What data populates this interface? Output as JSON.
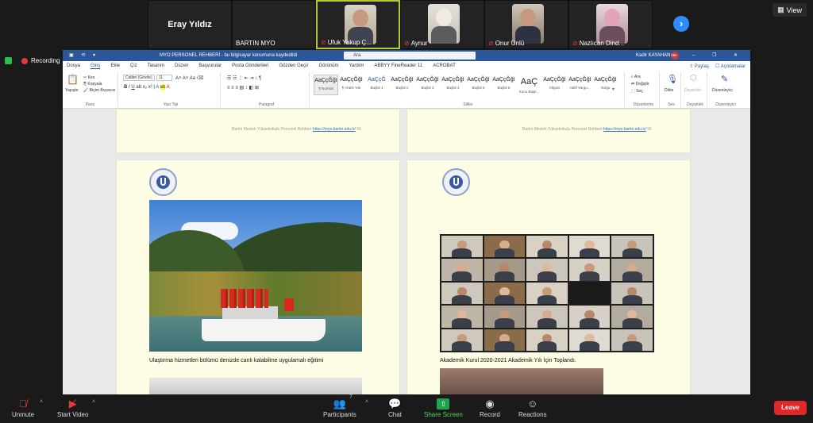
{
  "participants": [
    {
      "name": "Eray Yıldız",
      "has_video": false,
      "muted": false
    },
    {
      "name": "BARTIN MYO",
      "has_video": false,
      "muted": false
    },
    {
      "name": "Ufuk Yakup Ç...",
      "has_video": true,
      "muted": true,
      "active_speaker": true
    },
    {
      "name": "Aynur",
      "has_video": true,
      "muted": true
    },
    {
      "name": "Onur Ünlü",
      "has_video": true,
      "muted": true
    },
    {
      "name": "Nazlıcan Dind...",
      "has_video": true,
      "muted": true
    }
  ],
  "top": {
    "view_label": "View",
    "recording_label": "Recording",
    "next_icon": "chevron-right-icon"
  },
  "word": {
    "doc_title": "MYO PERSONEL REHBERİ  -  bu bilgisayar konumuna kaydedildi",
    "search_placeholder": "Ara",
    "user_name": "Kadir KAYAHAN",
    "user_initials": "KK",
    "menu": [
      "Dosya",
      "Giriş",
      "Ekle",
      "Çiz",
      "Tasarım",
      "Düzen",
      "Başvurular",
      "Posta Gönderileri",
      "Gözden Geçir",
      "Görünüm",
      "Yardım",
      "ABBYY FineReader 11",
      "ACROBAT"
    ],
    "active_menu": "Giriş",
    "share_label": "Paylaş",
    "comments_label": "Açıklamalar",
    "ribbon": {
      "paste": "Yapıştır",
      "cut": "Kes",
      "copy": "Kopyala",
      "format_painter": "Biçim Boyacısı",
      "clipboard_group": "Pano",
      "font_name": "Calibri (Gövde)",
      "font_size": "11",
      "font_group": "Yazı Tipi",
      "paragraph_group": "Paragraf",
      "styles_group": "Stiller",
      "styles": [
        {
          "sample": "AaÇçĞğI",
          "name": "¶ Normal"
        },
        {
          "sample": "AaÇçĞğI",
          "name": "¶ Aralık Yok"
        },
        {
          "sample": "AaÇçĞ",
          "name": "Başlık 1"
        },
        {
          "sample": "AaÇçĞğI",
          "name": "Başlık 2"
        },
        {
          "sample": "AaÇçĞğI",
          "name": "Başlık 3"
        },
        {
          "sample": "AaÇçĞğI",
          "name": "Başlık 4"
        },
        {
          "sample": "AaÇçĞğI",
          "name": "Başlık 5"
        },
        {
          "sample": "AaÇçĞğI",
          "name": "Başlık 6"
        },
        {
          "sample": "AaÇ",
          "name": "Konu Başlı..."
        },
        {
          "sample": "AaÇçĞğI",
          "name": "Altyazı"
        },
        {
          "sample": "AaÇçĞğI",
          "name": "Hafif Vurgu..."
        },
        {
          "sample": "AaÇçĞğI",
          "name": "Vurgu"
        }
      ],
      "find": "Ara",
      "replace": "Değiştir",
      "select": "Seç",
      "editing_group": "Düzenleme",
      "dictate": "Dikte",
      "voice_group": "Ses",
      "sensitivity": "Duyarlılık",
      "sensitivity_group": "Duyarlılık",
      "editor": "Düzenleyici",
      "editor_group": "Düzenleyici"
    },
    "pages": {
      "footer_text": "Bartın Meslek Yüksekokulu Personel Rehberi-",
      "footer_link": "https://myo.bartin.edu.tr/",
      "footer_page": "56",
      "footer_page_right": "56",
      "caption_left": "Ulaştırma hizmetleri bölümü denizde canlı kalabilme uygulamalı eğitimi",
      "caption_right": "Akademik Kurul 2020-2021 Akademik Yılı İçin Toplandı."
    }
  },
  "bottom": {
    "unmute": "Unmute",
    "start_video": "Start Video",
    "participants": "Participants",
    "participants_count": "7",
    "chat": "Chat",
    "share_screen": "Share Screen",
    "record": "Record",
    "reactions": "Reactions",
    "leave": "Leave"
  },
  "colors": {
    "accent": "#2d8cff",
    "word_blue": "#2b579a",
    "share_green": "#23a24d",
    "leave_red": "#e02828",
    "active_speaker": "#b8c736"
  }
}
